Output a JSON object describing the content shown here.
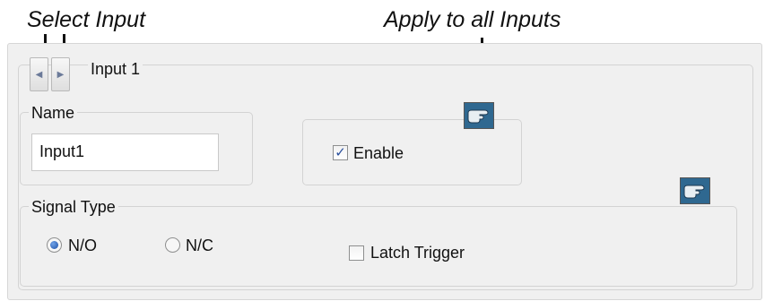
{
  "callouts": {
    "select_input": "Select Input",
    "apply_to_all": "Apply to all Inputs"
  },
  "header": {
    "title": "Input 1",
    "prev_icon": "triangle-left-icon",
    "next_icon": "triangle-right-icon"
  },
  "name_group": {
    "label": "Name",
    "value": "Input1"
  },
  "enable": {
    "label": "Enable",
    "checked": true
  },
  "signal_type": {
    "label": "Signal Type",
    "options": [
      {
        "label": "N/O",
        "selected": true
      },
      {
        "label": "N/C",
        "selected": false
      }
    ]
  },
  "latch_trigger": {
    "label": "Latch Trigger",
    "checked": false
  },
  "apply_icon": "pointing-hand-icon",
  "colors": {
    "panel_bg": "#f0f0f0",
    "check_mark": "#2a4f9c",
    "apply_button": "#3e7aa6"
  }
}
